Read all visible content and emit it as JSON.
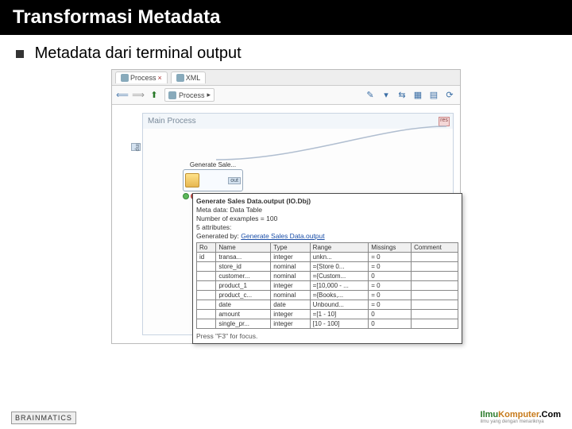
{
  "slide": {
    "title": "Transformasi Metadata",
    "subtitle": "Metadata dari terminal output"
  },
  "tabs": [
    {
      "label": "Process",
      "icon": "process-icon"
    },
    {
      "label": "XML",
      "icon": "xml-icon"
    }
  ],
  "breadcrumb": {
    "label": "Process",
    "icon": "process-icon"
  },
  "canvas": {
    "main_process_title": "Main Process",
    "inp_port": "inp",
    "res_port": "res"
  },
  "operator": {
    "label": "Generate Sale...",
    "port_out": "out"
  },
  "tooltip": {
    "title": "Generate Sales Data.output (IO.Dbj)",
    "meta_line": "Meta data: Data Table",
    "examples_line": "Number of examples = 100",
    "attrs_label": "5 attributes:",
    "genby_label": "Generated by:",
    "genby_link": "Generate Sales Data.output",
    "columns": [
      "Ro",
      "Name",
      "Type",
      "Range",
      "Missings",
      "Comment"
    ],
    "rows": [
      [
        "id",
        "transa...",
        "integer",
        "unkn...",
        "= 0",
        ""
      ],
      [
        "",
        "store_id",
        "nominal",
        "={Store 0...",
        "= 0",
        ""
      ],
      [
        "",
        "customer...",
        "nominal",
        "={Custom...",
        "0",
        ""
      ],
      [
        "",
        "product_1",
        "integer",
        "=[10,000 - ...",
        "= 0",
        ""
      ],
      [
        "",
        "product_c...",
        "nominal",
        "={Books,...",
        "= 0",
        ""
      ],
      [
        "",
        "date",
        "date",
        "Unbound...",
        "= 0",
        ""
      ],
      [
        "",
        "amount",
        "integer",
        "=[1 - 10]",
        "0",
        ""
      ],
      [
        "",
        "single_pr...",
        "integer",
        "[10 - 100]",
        "0",
        ""
      ]
    ],
    "footer": "Press \"F3\" for focus."
  },
  "footer": {
    "left": "BRAINMATICS",
    "right_a": "Ilmu",
    "right_b": "Komputer",
    "right_c": ".Com",
    "right_sub": "ilmu yang dengan menariknya"
  }
}
